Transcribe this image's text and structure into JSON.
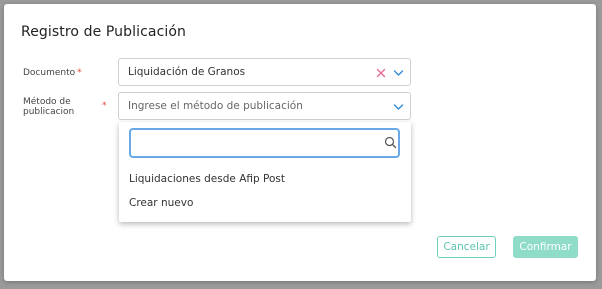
{
  "dialog": {
    "title": "Registro de Publicación"
  },
  "documento": {
    "label": "Documento",
    "required_mark": "*",
    "value": "Liquidación de Granos"
  },
  "metodo": {
    "label": "Método de publicacion",
    "required_mark": "*",
    "placeholder": "Ingrese el método de publicación"
  },
  "dropdown": {
    "search_value": "",
    "options": [
      "Liquidaciones desde Afip Post",
      "Crear nuevo"
    ]
  },
  "footer": {
    "cancel_label": "Cancelar",
    "confirm_label": "Confirmar"
  },
  "colors": {
    "accent": "#5cc4ae",
    "confirm_disabled": "#8fdcc9",
    "clear_icon": "#e86c9a",
    "chevron": "#3b8fd9",
    "focus_border": "#6aa9e8",
    "required": "#e2453c"
  }
}
